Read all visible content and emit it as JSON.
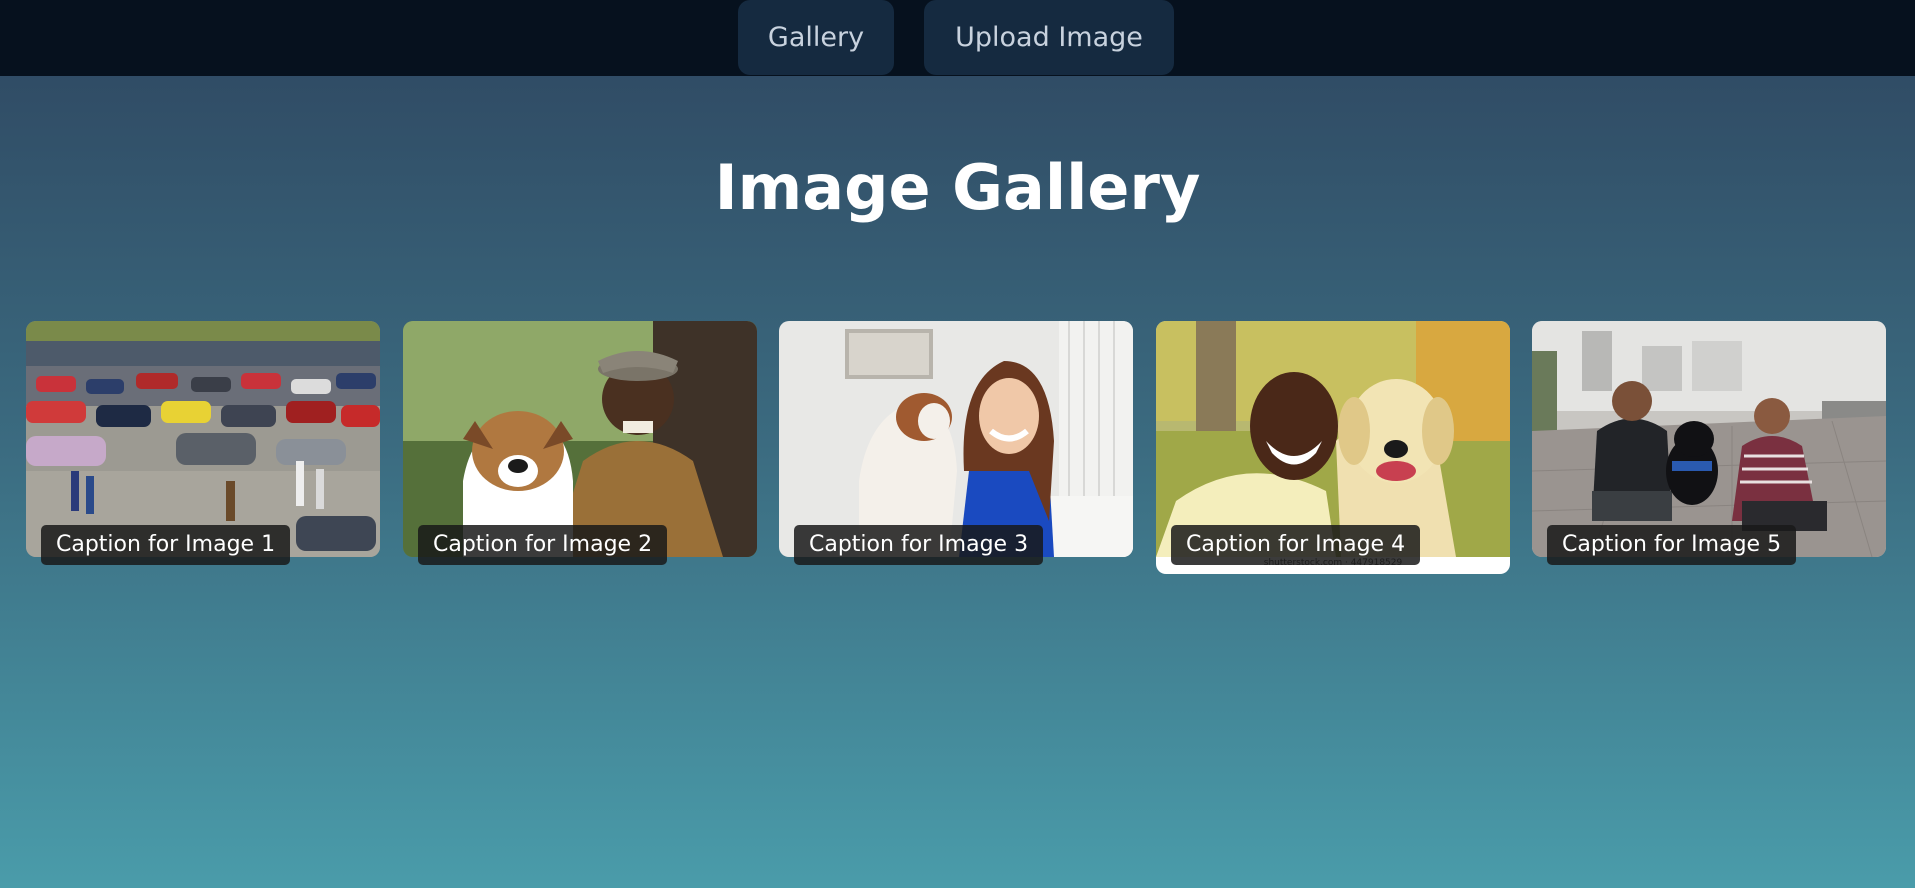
{
  "nav": {
    "gallery_label": "Gallery",
    "upload_label": "Upload Image"
  },
  "page": {
    "title": "Image Gallery"
  },
  "gallery": {
    "items": [
      {
        "caption": "Caption for Image 1",
        "subject": "car park crowd photo"
      },
      {
        "caption": "Caption for Image 2",
        "subject": "man with boxer dog photo"
      },
      {
        "caption": "Caption for Image 3",
        "subject": "woman hugging puppy photo"
      },
      {
        "caption": "Caption for Image 4",
        "subject": "man with golden retriever photo",
        "watermark": "shutterstock.com · 447918529"
      },
      {
        "caption": "Caption for Image 5",
        "subject": "couple with black dog photo"
      }
    ]
  },
  "colors": {
    "navbar": "#06111e",
    "nav_button": "#152a40",
    "gradient_top": "#2e4660",
    "gradient_bottom": "#4a9caa"
  }
}
